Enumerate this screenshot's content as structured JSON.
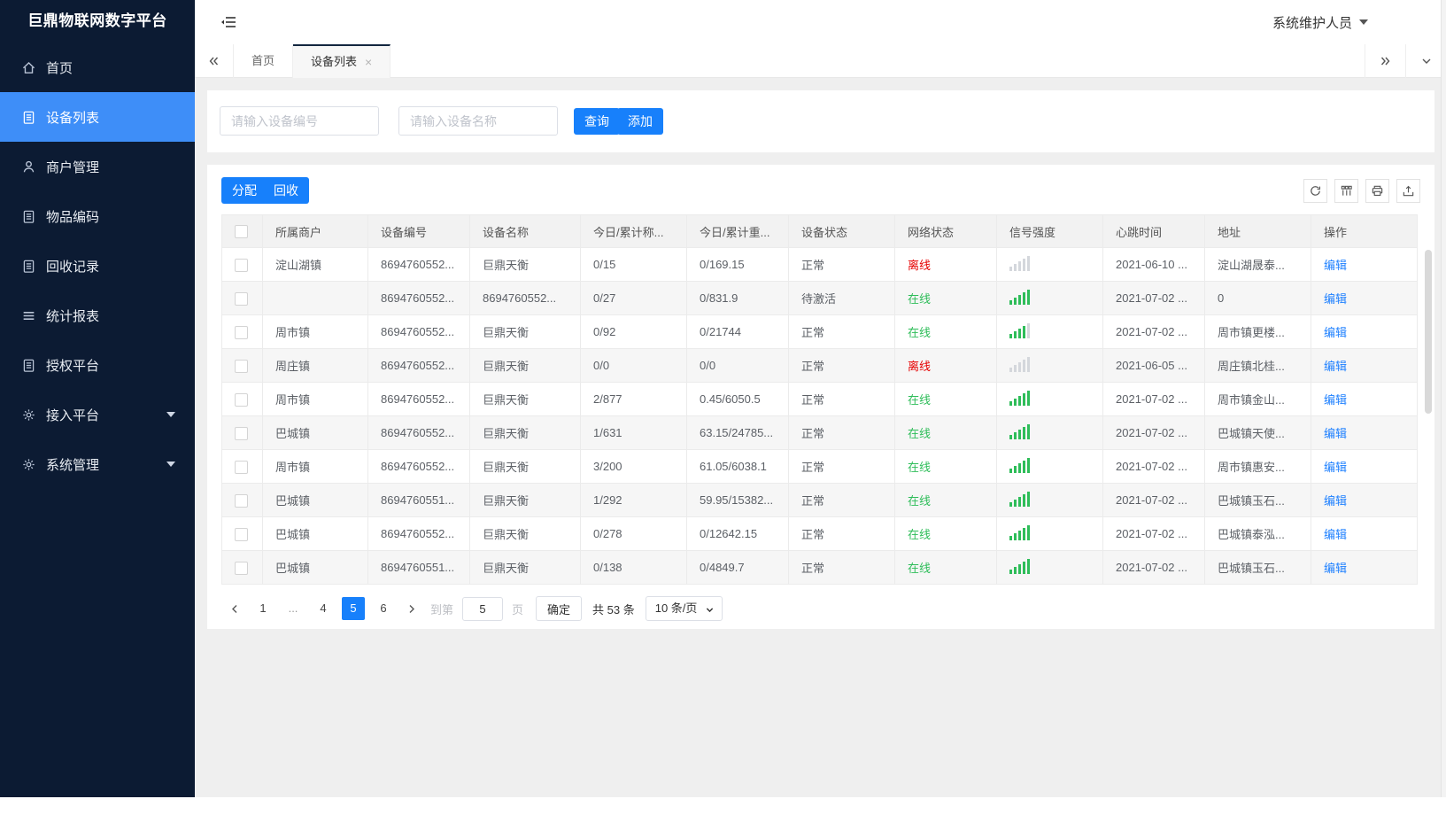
{
  "app": {
    "logo_title": "巨鼎物联网数字平台",
    "user_name": "系统维护人员"
  },
  "sidebar": {
    "items": [
      {
        "label": "首页",
        "icon": "home"
      },
      {
        "label": "设备列表",
        "icon": "clipboard",
        "active": true
      },
      {
        "label": "商户管理",
        "icon": "user"
      },
      {
        "label": "物品编码",
        "icon": "clipboard"
      },
      {
        "label": "回收记录",
        "icon": "clipboard"
      },
      {
        "label": "统计报表",
        "icon": "lines"
      },
      {
        "label": "授权平台",
        "icon": "clipboard"
      },
      {
        "label": "接入平台",
        "icon": "gear",
        "expandable": true
      },
      {
        "label": "系统管理",
        "icon": "gear",
        "expandable": true
      }
    ]
  },
  "tabs": {
    "items": [
      {
        "label": "首页"
      },
      {
        "label": "设备列表",
        "active": true,
        "closable": true
      }
    ],
    "close_glyph": "×"
  },
  "filters": {
    "device_no_placeholder": "请输入设备编号",
    "device_name_placeholder": "请输入设备名称",
    "search_label": "查询",
    "add_label": "添加"
  },
  "table_toolbar": {
    "assign_label": "分配",
    "recycle_label": "回收"
  },
  "table": {
    "columns": [
      {
        "key": "checkbox",
        "label": ""
      },
      {
        "key": "merchant",
        "label": "所属商户"
      },
      {
        "key": "device-no",
        "label": "设备编号"
      },
      {
        "key": "device-name",
        "label": "设备名称"
      },
      {
        "key": "today-count",
        "label": "今日/累计称..."
      },
      {
        "key": "today-weight",
        "label": "今日/累计重..."
      },
      {
        "key": "device-status",
        "label": "设备状态"
      },
      {
        "key": "network-status",
        "label": "网络状态"
      },
      {
        "key": "signal",
        "label": "信号强度"
      },
      {
        "key": "heartbeat",
        "label": "心跳时间"
      },
      {
        "key": "address",
        "label": "地址"
      },
      {
        "key": "actions",
        "label": "操作"
      }
    ],
    "rows": [
      {
        "merchant": "淀山湖镇",
        "device_no": "8694760552...",
        "device_name": "巨鼎天衡",
        "today_count": "0/15",
        "today_weight": "0/169.15",
        "device_status": "正常",
        "network_status": "离线",
        "network_state": "offline",
        "signal_level": 0,
        "heartbeat": "2021-06-10 ...",
        "address": "淀山湖晟泰...",
        "action": "编辑"
      },
      {
        "merchant": "",
        "device_no": "8694760552...",
        "device_name": "8694760552...",
        "today_count": "0/27",
        "today_weight": "0/831.9",
        "device_status": "待激活",
        "network_status": "在线",
        "network_state": "online",
        "signal_level": 5,
        "heartbeat": "2021-07-02 ...",
        "address": "0",
        "action": "编辑"
      },
      {
        "merchant": "周市镇",
        "device_no": "8694760552...",
        "device_name": "巨鼎天衡",
        "today_count": "0/92",
        "today_weight": "0/21744",
        "device_status": "正常",
        "network_status": "在线",
        "network_state": "online",
        "signal_level": 4,
        "heartbeat": "2021-07-02 ...",
        "address": "周市镇更楼...",
        "action": "编辑"
      },
      {
        "merchant": "周庄镇",
        "device_no": "8694760552...",
        "device_name": "巨鼎天衡",
        "today_count": "0/0",
        "today_weight": "0/0",
        "device_status": "正常",
        "network_status": "离线",
        "network_state": "offline",
        "signal_level": 0,
        "heartbeat": "2021-06-05 ...",
        "address": "周庄镇北桂...",
        "action": "编辑"
      },
      {
        "merchant": "周市镇",
        "device_no": "8694760552...",
        "device_name": "巨鼎天衡",
        "today_count": "2/877",
        "today_weight": "0.45/6050.5",
        "device_status": "正常",
        "network_status": "在线",
        "network_state": "online",
        "signal_level": 5,
        "heartbeat": "2021-07-02 ...",
        "address": "周市镇金山...",
        "action": "编辑"
      },
      {
        "merchant": "巴城镇",
        "device_no": "8694760552...",
        "device_name": "巨鼎天衡",
        "today_count": "1/631",
        "today_weight": "63.15/24785...",
        "device_status": "正常",
        "network_status": "在线",
        "network_state": "online",
        "signal_level": 5,
        "heartbeat": "2021-07-02 ...",
        "address": "巴城镇天使...",
        "action": "编辑"
      },
      {
        "merchant": "周市镇",
        "device_no": "8694760552...",
        "device_name": "巨鼎天衡",
        "today_count": "3/200",
        "today_weight": "61.05/6038.1",
        "device_status": "正常",
        "network_status": "在线",
        "network_state": "online",
        "signal_level": 5,
        "heartbeat": "2021-07-02 ...",
        "address": "周市镇惠安...",
        "action": "编辑"
      },
      {
        "merchant": "巴城镇",
        "device_no": "8694760551...",
        "device_name": "巨鼎天衡",
        "today_count": "1/292",
        "today_weight": "59.95/15382...",
        "device_status": "正常",
        "network_status": "在线",
        "network_state": "online",
        "signal_level": 5,
        "heartbeat": "2021-07-02 ...",
        "address": "巴城镇玉石...",
        "action": "编辑"
      },
      {
        "merchant": "巴城镇",
        "device_no": "8694760552...",
        "device_name": "巨鼎天衡",
        "today_count": "0/278",
        "today_weight": "0/12642.15",
        "device_status": "正常",
        "network_status": "在线",
        "network_state": "online",
        "signal_level": 5,
        "heartbeat": "2021-07-02 ...",
        "address": "巴城镇泰泓...",
        "action": "编辑"
      },
      {
        "merchant": "巴城镇",
        "device_no": "8694760551...",
        "device_name": "巨鼎天衡",
        "today_count": "0/138",
        "today_weight": "0/4849.7",
        "device_status": "正常",
        "network_status": "在线",
        "network_state": "online",
        "signal_level": 5,
        "heartbeat": "2021-07-02 ...",
        "address": "巴城镇玉石...",
        "action": "编辑"
      }
    ]
  },
  "pagination": {
    "pages": [
      "1",
      "...",
      "4",
      "5",
      "6"
    ],
    "active_page": "5",
    "goto_label": "到第",
    "goto_value": "5",
    "page_unit_label": "页",
    "confirm_label": "确定",
    "total_label": "共 53 条",
    "page_size_label": "10 条/页"
  },
  "colors": {
    "accent_blue": "#1780fb",
    "sidebar_active_blue": "#3e8ef8",
    "online_green": "#2ebd59",
    "offline_red": "#e60000",
    "link_blue": "#1e80ff"
  }
}
